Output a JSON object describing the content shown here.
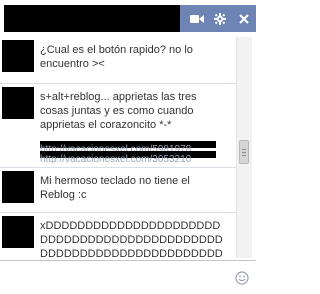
{
  "header": {
    "title_redacted": true,
    "controls": [
      {
        "name": "video-call",
        "icon": "video-camera-icon"
      },
      {
        "name": "settings",
        "icon": "gear-icon"
      },
      {
        "name": "close",
        "icon": "close-icon"
      }
    ],
    "accent": "#6d84b4"
  },
  "messages": [
    {
      "text": "¿Cual es el botón rapido? no lo encuentro ><"
    },
    {
      "text": "s+alt+reblog... apprietas las tres cosas juntas y es como cuando apprietas el corazoncito *-*",
      "links": [
        "http://vacacionesxel.com/5981978",
        "http://vacacionesxel.com/3053210"
      ]
    },
    {
      "text": "Mi hermoso teclado no tiene el Reblog :c"
    },
    {
      "text": "xDDDDDDDDDDDDDDDDDDDDDDDDDDDDDDDDDDDDDDDDDDDDDDDDDDDDDDDDDDDDDDDDDDDDDDDDDDDDDDDDDDDDDDDDDDDDDDDDDDDD"
    }
  ],
  "composer": {
    "placeholder": "",
    "value": "",
    "emoji_icon": "smiley-icon"
  }
}
